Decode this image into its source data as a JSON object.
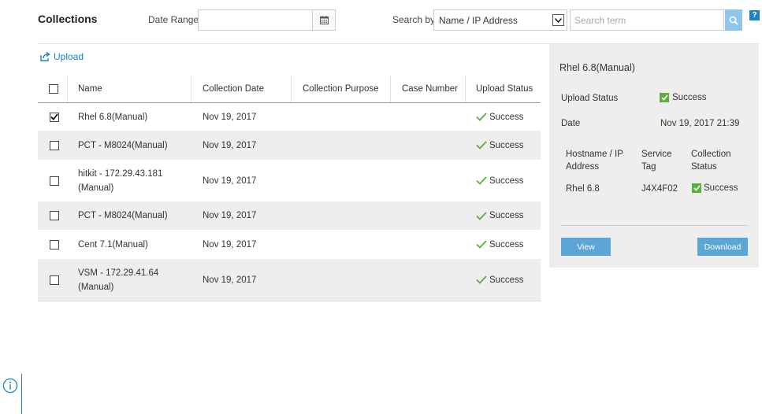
{
  "header": {
    "title": "Collections",
    "date_range_label": "Date Range:",
    "date_range_value": "",
    "search_by_label": "Search by",
    "search_by_selected": "Name / IP Address",
    "search_placeholder": "Search term",
    "help_label": "?"
  },
  "upload": {
    "label": "Upload"
  },
  "table": {
    "columns": [
      "Name",
      "Collection Date",
      "Collection Purpose",
      "Case Number",
      "Upload Status"
    ],
    "rows": [
      {
        "name": "Rhel 6.8(Manual)",
        "date": "Nov 19, 2017",
        "purpose": "",
        "case": "",
        "status": "Success",
        "checked": true
      },
      {
        "name": "PCT - M8024(Manual)",
        "date": "Nov 19, 2017",
        "purpose": "",
        "case": "",
        "status": "Success",
        "checked": false
      },
      {
        "name": "hitkit - 172.29.43.181 (Manual)",
        "date": "Nov 19, 2017",
        "purpose": "",
        "case": "",
        "status": "Success",
        "checked": false
      },
      {
        "name": "PCT - M8024(Manual)",
        "date": "Nov 19, 2017",
        "purpose": "",
        "case": "",
        "status": "Success",
        "checked": false
      },
      {
        "name": "Cent 7.1(Manual)",
        "date": "Nov 19, 2017",
        "purpose": "",
        "case": "",
        "status": "Success",
        "checked": false
      },
      {
        "name": "VSM - 172.29.41.64 (Manual)",
        "date": "Nov 19, 2017",
        "purpose": "",
        "case": "",
        "status": "Success",
        "checked": false
      }
    ]
  },
  "detail": {
    "title": "Rhel 6.8(Manual)",
    "upload_status_label": "Upload Status",
    "upload_status_value": "Success",
    "date_label": "Date",
    "date_value": "Nov 19, 2017 21:39",
    "sub_columns": [
      "Hostname / IP Address",
      "Service Tag",
      "Collection Status"
    ],
    "sub_row": {
      "hostname": "Rhel 6.8",
      "service_tag": "J4X4F02",
      "status": "Success"
    },
    "view_label": "View",
    "download_label": "Download"
  },
  "colors": {
    "accent": "#1a82c6",
    "button": "#5ba6d6",
    "success": "#5cae3c",
    "panel_bg": "#eeeeee",
    "row_alt": "#eeeeee"
  },
  "icons": [
    "calendar-icon",
    "chevron-down-icon",
    "search-icon",
    "help-icon",
    "upload-icon",
    "checkmark-icon",
    "info-icon"
  ]
}
